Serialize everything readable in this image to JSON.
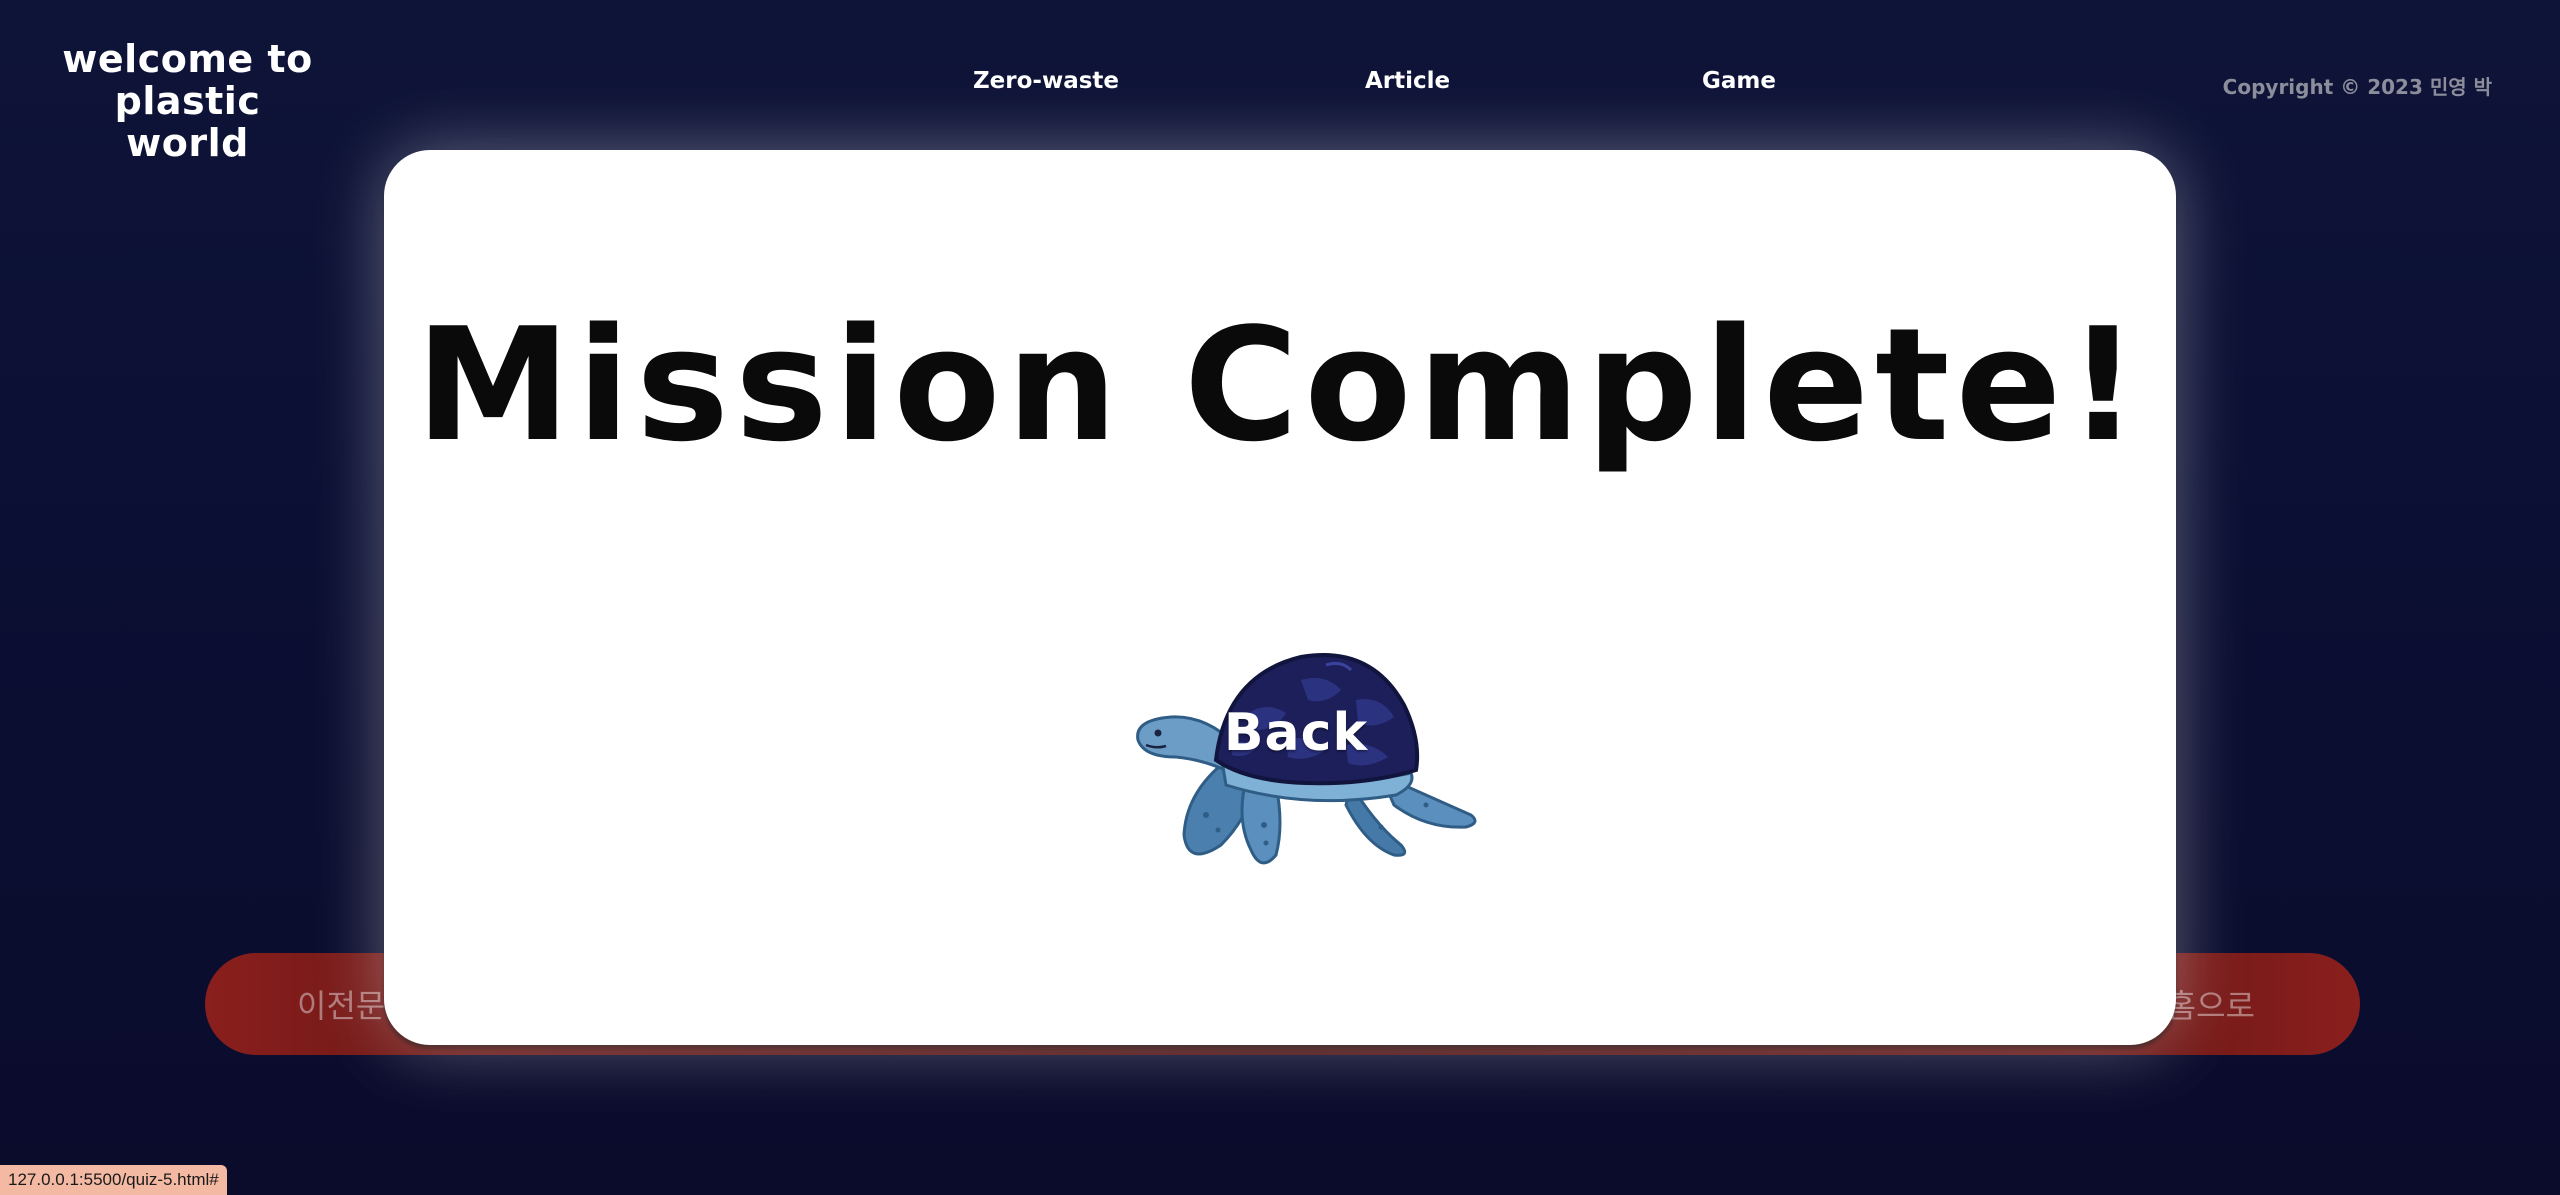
{
  "header": {
    "logo_line1": "welcome to",
    "logo_line2": "plastic world",
    "nav": [
      "Zero-waste",
      "Article",
      "Game"
    ],
    "copyright": "Copyright © 2023 민영 박"
  },
  "quiz_bar": {
    "prev_label": "이전문",
    "home_label": "홈으로"
  },
  "modal": {
    "title": "Mission Complete!",
    "back_label": "Back"
  },
  "status_bar": {
    "url": "127.0.0.1:5500/quiz-5.html#"
  },
  "colors": {
    "background": "#0d1236",
    "modal": "#ffffff",
    "pill": "#6a1716",
    "turtle_shell": "#1c1f5a",
    "turtle_body": "#5b8fbd",
    "status_bar": "#f3b9a3"
  },
  "icons": [
    "turtle-icon"
  ]
}
